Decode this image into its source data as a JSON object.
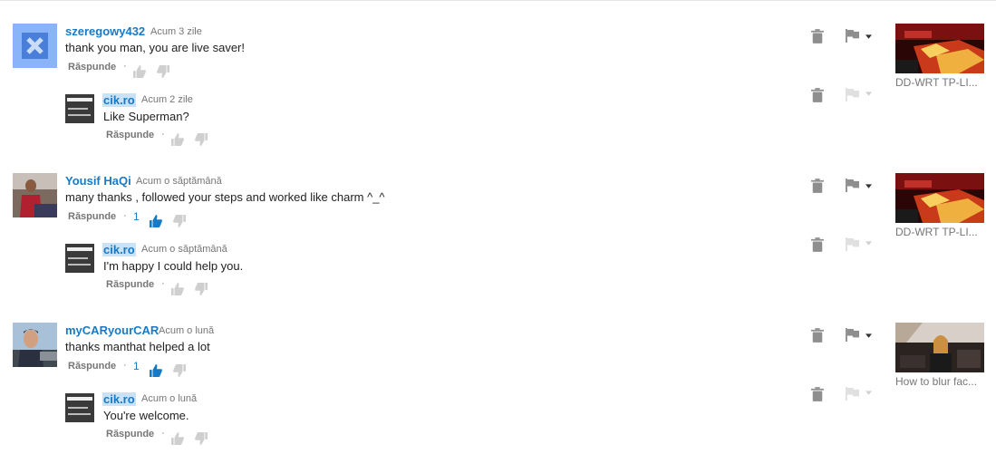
{
  "comments": [
    {
      "author": "szeregowy432",
      "time": "Acum 3 zile",
      "text": "thank you man, you are live saver!",
      "reply_label": "Răspunde",
      "likes": "",
      "video_title": "DD-WRT TP-LI...",
      "reply": {
        "author": "cik.ro",
        "time": "Acum 2 zile",
        "text": "Like Superman?",
        "reply_label": "Răspunde"
      }
    },
    {
      "author": "Yousif HaQi",
      "time": "Acum o săptămână",
      "text": "many thanks , followed your steps and worked like charm ^_^",
      "reply_label": "Răspunde",
      "likes": "1",
      "video_title": "DD-WRT TP-LI...",
      "reply": {
        "author": "cik.ro",
        "time": "Acum o săptămână",
        "text": "I'm happy I could help you.",
        "reply_label": "Răspunde"
      }
    },
    {
      "author": "myCARyourCAR",
      "time": "Acum o lună",
      "text": "thanks manthat helped a lot",
      "reply_label": "Răspunde",
      "likes": "1",
      "video_title": "How to blur fac...",
      "reply": {
        "author": "cik.ro",
        "time": "Acum o lună",
        "text": "You're welcome.",
        "reply_label": "Răspunde"
      }
    }
  ],
  "channel_logo_text": "CIK.RO",
  "icons": {
    "delete": "trash-icon",
    "flag": "flag-icon",
    "menu": "dropdown-arrow-icon",
    "like": "thumbs-up-icon",
    "dislike": "thumbs-down-icon"
  },
  "colors": {
    "link": "#167ac6",
    "muted": "#767676",
    "icon": "#8e8e8e",
    "icon_light": "#e0e0e0"
  }
}
